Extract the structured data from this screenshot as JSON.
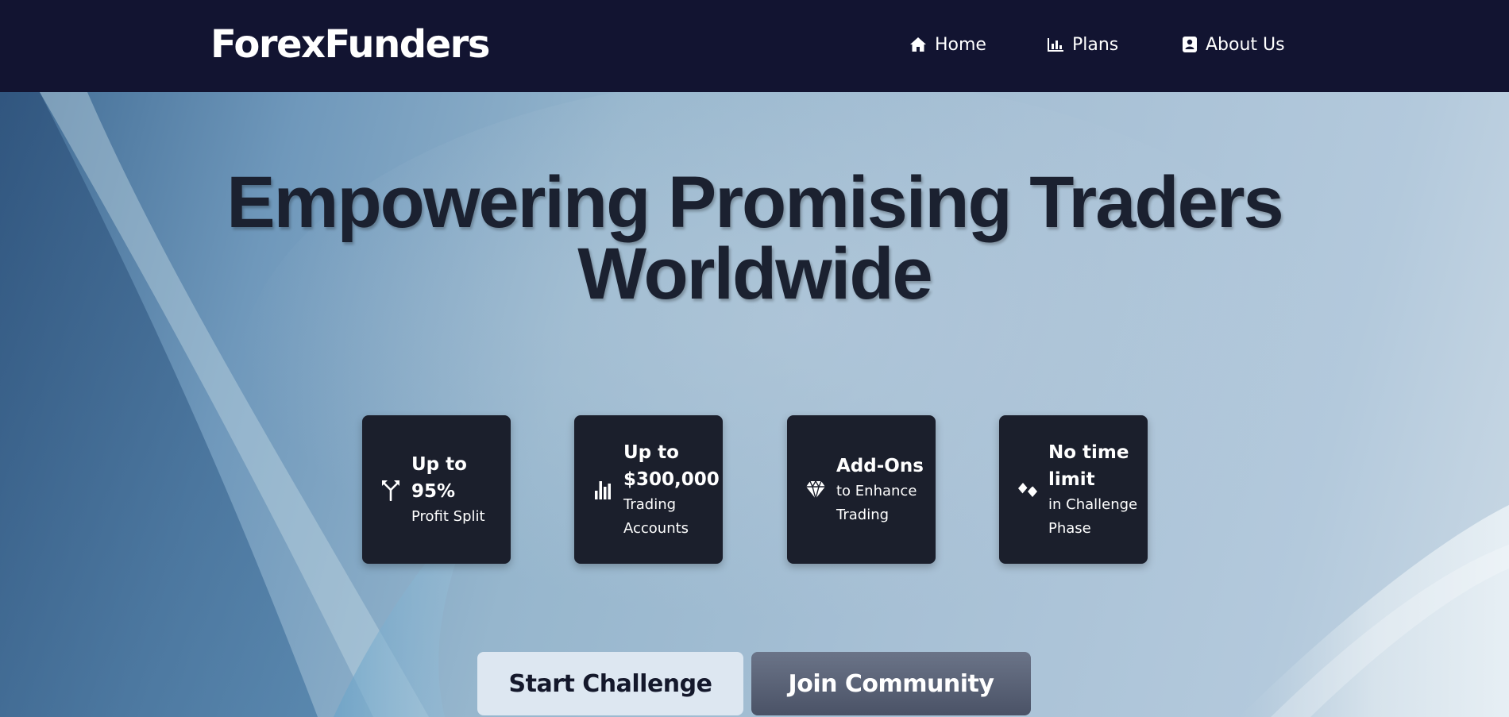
{
  "brand": {
    "logo_text": "ForexFunders"
  },
  "nav": {
    "items": [
      {
        "label": "Home",
        "icon": "home-icon"
      },
      {
        "label": "Plans",
        "icon": "bar-chart-icon"
      },
      {
        "label": "About Us",
        "icon": "contact-card-icon"
      }
    ]
  },
  "hero": {
    "headline_line1": "Empowering Promising Traders",
    "headline_line2": "Worldwide"
  },
  "features": [
    {
      "icon": "split-arrows-icon",
      "title_line1": "Up to",
      "title_line2": "95%",
      "desc_line1": "Profit Split",
      "desc_line2": ""
    },
    {
      "icon": "bar-chart-icon",
      "title_line1": "Up to",
      "title_line2": "$300,000",
      "desc_line1": "Trading",
      "desc_line2": "Accounts"
    },
    {
      "icon": "diamond-icon",
      "title_line1": "Add-Ons",
      "title_line2": "",
      "desc_line1": "to Enhance",
      "desc_line2": "Trading"
    },
    {
      "icon": "infinity-diamond-icon",
      "title_line1": "No time",
      "title_line2": "limit",
      "desc_line1": "in Challenge",
      "desc_line2": "Phase"
    }
  ],
  "buttons": {
    "start": "Start Challenge",
    "join": "Join Community"
  },
  "colors": {
    "nav_bg": "#121431",
    "card_bg": "#1b1f2c",
    "headline": "#1b2130",
    "start_button_bg": "#dde7f1",
    "join_button_bg": "#4a5266"
  }
}
